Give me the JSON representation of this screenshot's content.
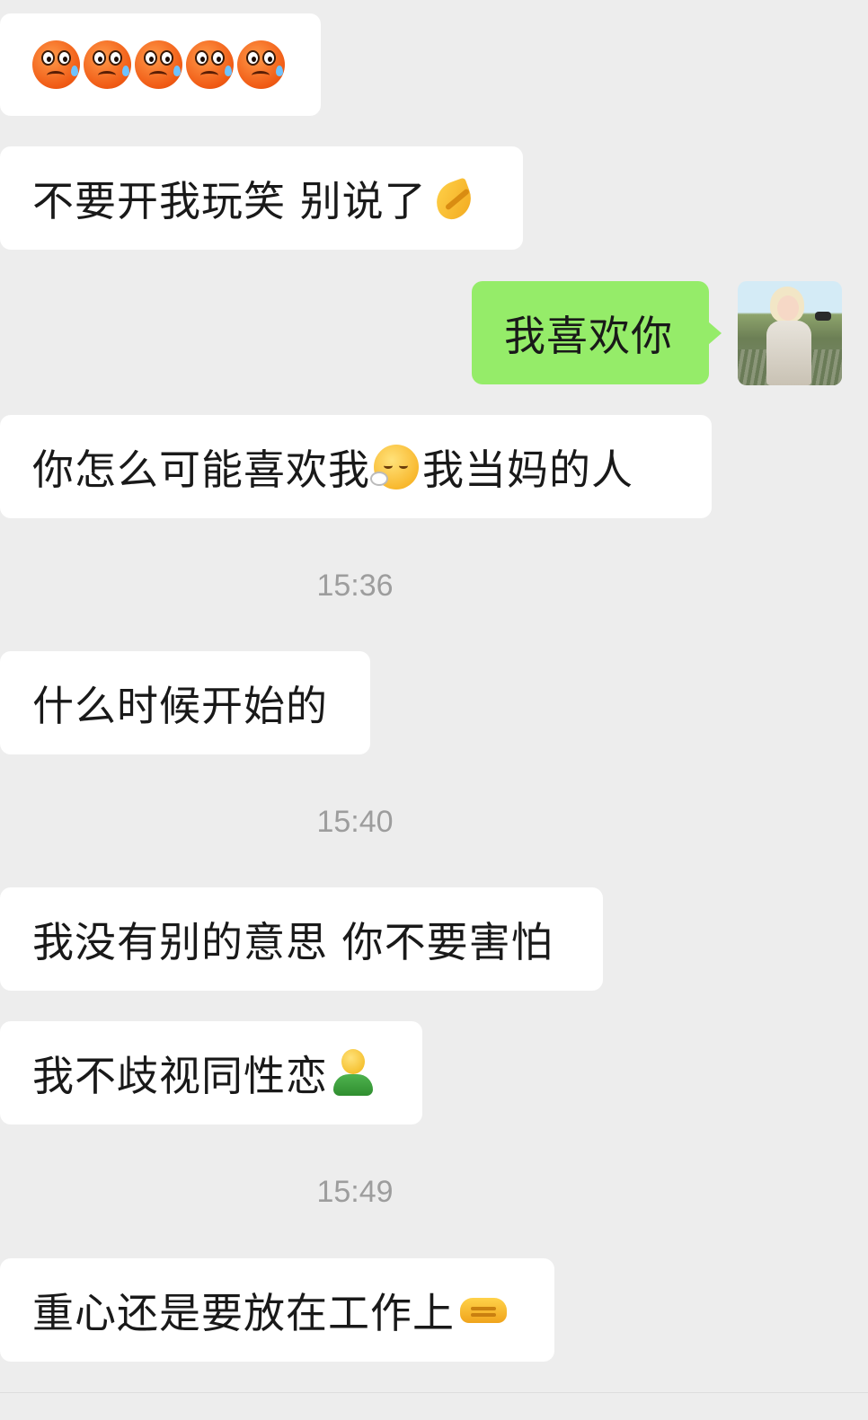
{
  "messages": [
    {
      "side": "left",
      "text": "",
      "emoji_after": [
        "crying-face",
        "crying-face",
        "crying-face",
        "crying-face",
        "crying-face"
      ]
    },
    {
      "side": "left",
      "text": "不要开我玩笑 别说了",
      "emoji_after": [
        "folded-hands"
      ]
    },
    {
      "side": "right",
      "text": "我喜欢你"
    },
    {
      "side": "left",
      "text_before": "你怎么可能喜欢我",
      "emoji_mid": "face-exhaling",
      "text_after": "我当妈的人"
    },
    {
      "time": "15:36"
    },
    {
      "side": "left",
      "text": "什么时候开始的"
    },
    {
      "time": "15:40"
    },
    {
      "side": "left",
      "text": "我没有别的意思 你不要害怕"
    },
    {
      "side": "left",
      "text": "我不歧视同性恋",
      "emoji_after": [
        "person-green"
      ]
    },
    {
      "time": "15:49"
    },
    {
      "side": "left",
      "text": "重心还是要放在工作上",
      "emoji_after": [
        "handshake"
      ]
    }
  ],
  "colors": {
    "background": "#ededed",
    "incoming_bubble": "#ffffff",
    "outgoing_bubble": "#95ec69",
    "timestamp": "#9d9d9d"
  }
}
